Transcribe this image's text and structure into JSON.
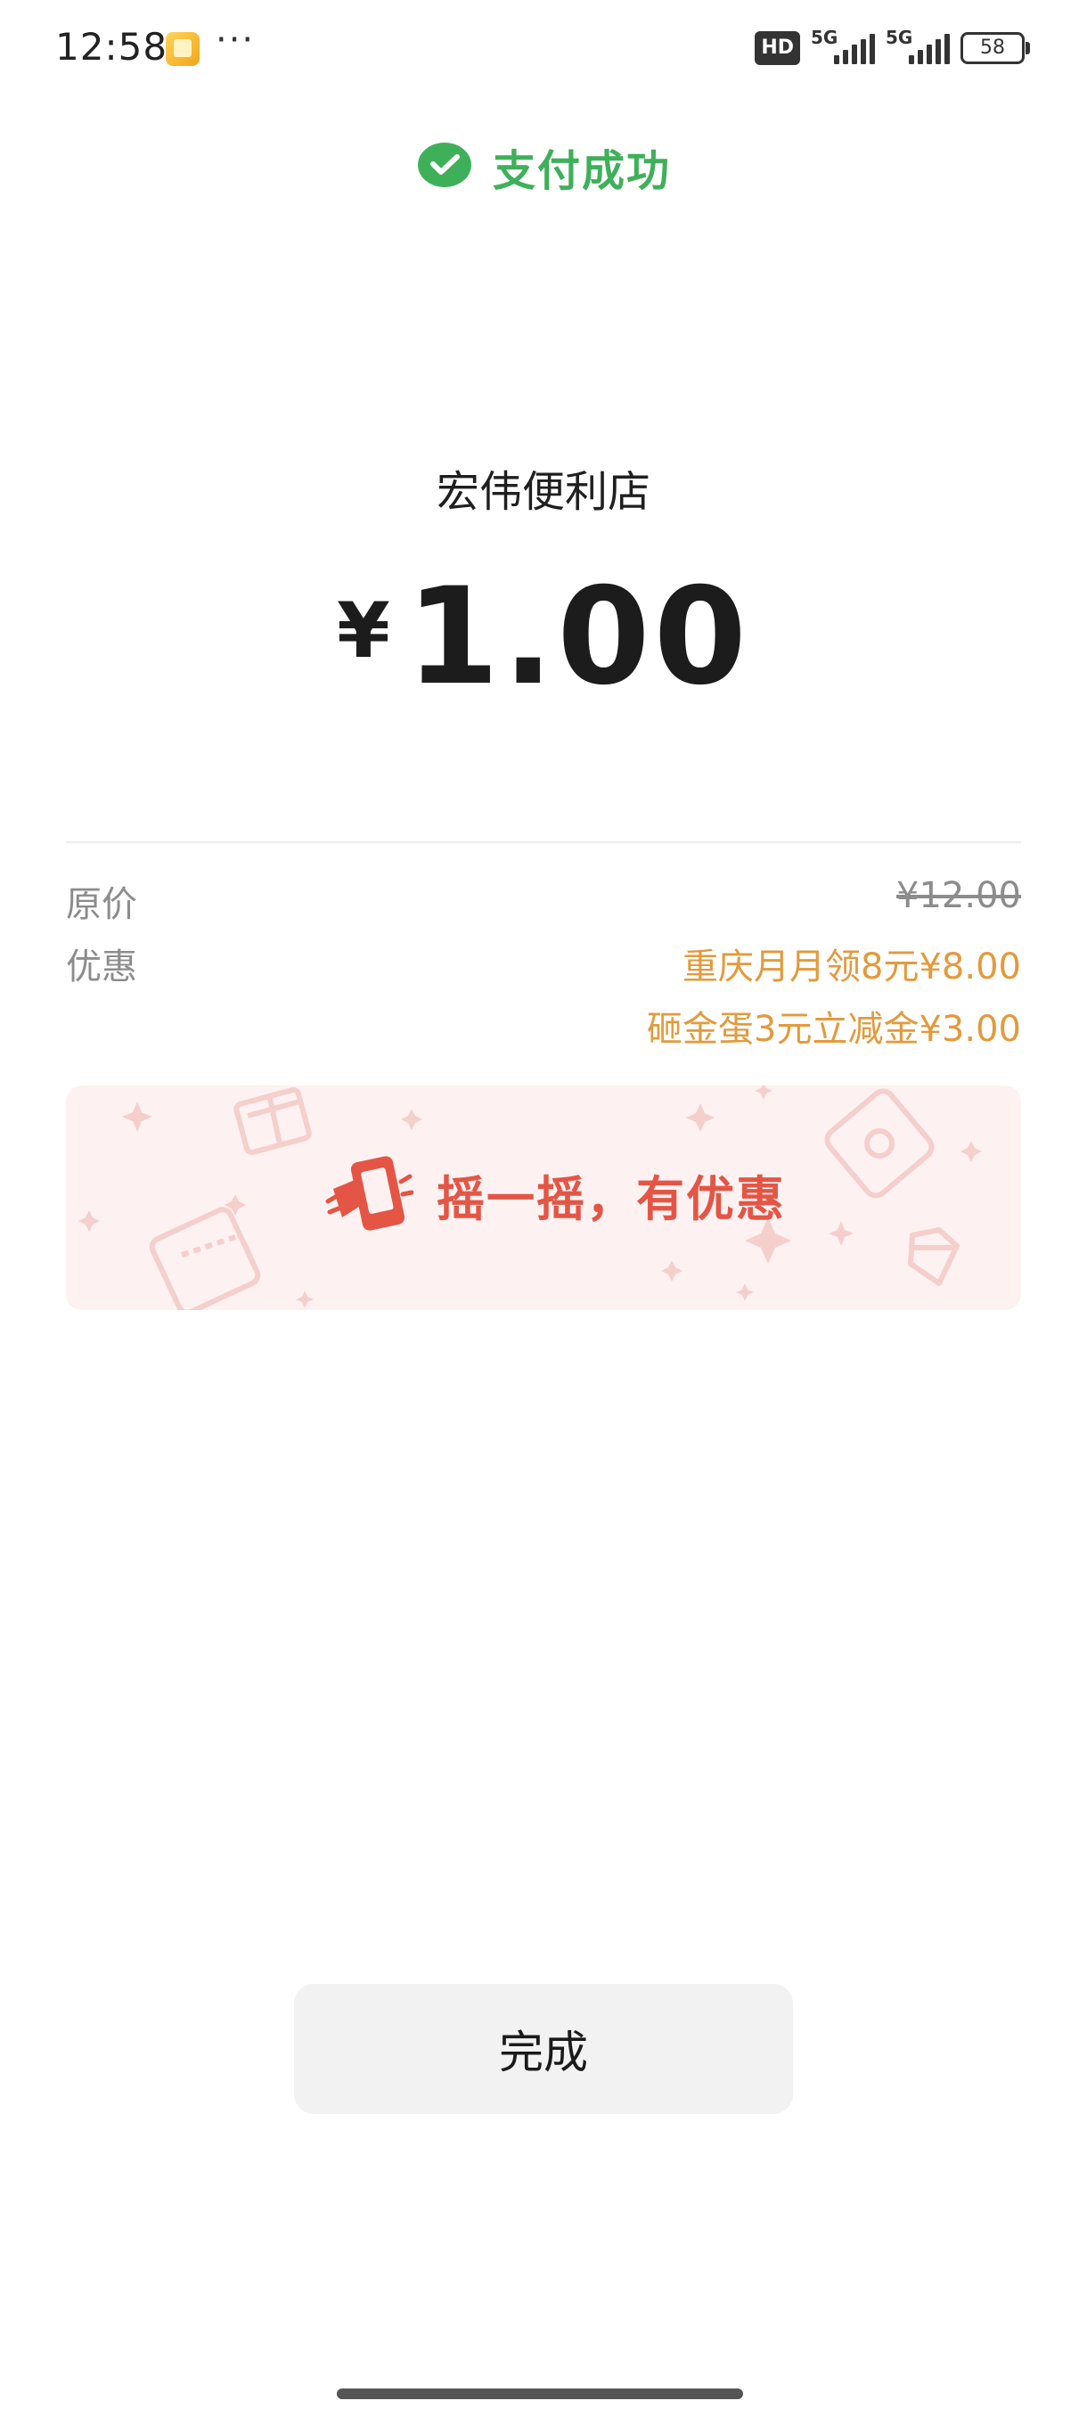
{
  "status_bar": {
    "time": "12:58",
    "more": "···",
    "hd_badge": "HD",
    "signal1_label": "5G",
    "signal2_label": "5G",
    "battery": "58"
  },
  "header": {
    "title": "支付成功",
    "icon": "wechat-pay-icon",
    "color": "#3fb05a"
  },
  "merchant": "宏伟便利店",
  "amount": {
    "currency": "¥",
    "value": "1.00"
  },
  "details": {
    "original_label": "原价",
    "original_value": "¥12.00",
    "discount_label": "优惠",
    "discounts": [
      "重庆月月领8元¥8.00",
      "砸金蛋3元立减金¥3.00"
    ],
    "discount_color": "#e39a3c"
  },
  "banner": {
    "text": "摇一摇，有优惠",
    "icon": "shake-phone-icon",
    "color": "#e45545"
  },
  "done_button": "完成"
}
